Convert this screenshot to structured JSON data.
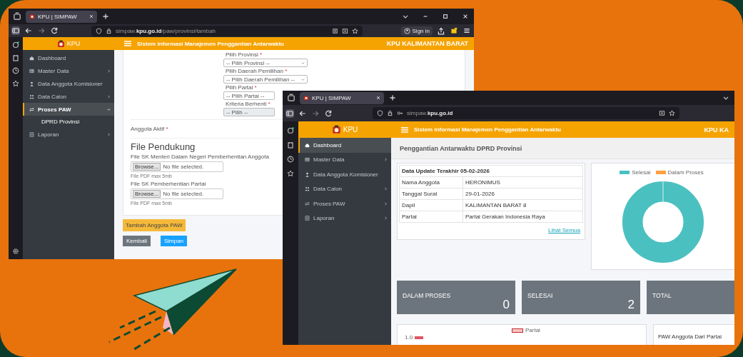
{
  "back_window": {
    "tab_title": "KPU | SIMPAW",
    "url": "simpaw.**kpu.go.id**/paw/provinsi/tambah",
    "sign_in": "Sign in",
    "app": {
      "logo": "KPU",
      "system_title": "Sistem Informasi Manajemen Penggantian Antarwaktu",
      "region": "KPU KALIMANTAN BARAT"
    },
    "sidebar": [
      {
        "label": "Dashboard",
        "selected": false,
        "expandable": false,
        "expanded": false
      },
      {
        "label": "Master Data",
        "selected": false,
        "expandable": true,
        "expanded": false
      },
      {
        "label": "Data Anggota Komisioner",
        "selected": false,
        "expandable": false,
        "expanded": false
      },
      {
        "label": "Data Calon",
        "selected": false,
        "expandable": true,
        "expanded": false
      },
      {
        "label": "Proses PAW",
        "selected": true,
        "expandable": true,
        "expanded": true,
        "children": [
          {
            "label": "DPRD Provinsi"
          }
        ]
      },
      {
        "label": "Laporan",
        "selected": false,
        "expandable": true,
        "expanded": false
      }
    ],
    "fields": [
      {
        "label": "Pilih Provinsi",
        "required_mark": "*",
        "placeholder": "-- Pilih Provinsi --",
        "disabled": false
      },
      {
        "label": "Pilih Daerah Pemilihan",
        "required_mark": "*",
        "placeholder": "-- Pilih Daerah Pemilihan --",
        "disabled": false
      },
      {
        "label": "Pilih Partai",
        "required_mark": "*",
        "placeholder": "-- Pilih Partai --",
        "disabled": false
      },
      {
        "label": "Kriteria Berhenti",
        "required_mark": "*",
        "placeholder": "-- Pilih --",
        "disabled": true
      }
    ],
    "anggota_aktif": {
      "label": "Anggota Aktif",
      "required_mark": "*"
    },
    "section_title": "File Pendukung",
    "uploads": [
      {
        "label": "File SK Menteri Dalam Negeri Pemberhentian Anggota",
        "button": "Browse...",
        "status": "No file selected.",
        "hint": "File PDF max 5mb"
      },
      {
        "label": "File SK Pemberhentian Partai",
        "button": "Browse...",
        "status": "No file selected.",
        "hint": "File PDF max 5mb"
      }
    ],
    "add_button": "Tambah Anggota PAW",
    "actions": [
      {
        "label": "Kembali",
        "kind": "secondary"
      },
      {
        "label": "Simpan",
        "kind": "primary"
      }
    ]
  },
  "front_window": {
    "tab_title": "KPU | SIMPAW",
    "url": "simpaw.**kpu.go.id**",
    "app": {
      "logo": "KPU",
      "system_title": "Sistem Informasi Manajemen Penggantian Antarwaktu",
      "region": "KPU KA"
    },
    "sidebar": [
      {
        "label": "Dashboard",
        "selected": true,
        "expandable": false
      },
      {
        "label": "Master Data",
        "selected": false,
        "expandable": true
      },
      {
        "label": "Data Anggota Komisioner",
        "selected": false,
        "expandable": false
      },
      {
        "label": "Data Calon",
        "selected": false,
        "expandable": true
      },
      {
        "label": "Proses PAW",
        "selected": false,
        "expandable": true
      },
      {
        "label": "Laporan",
        "selected": false,
        "expandable": true
      }
    ],
    "page_title": "Penggantian Antarwaktu DPRD Provinsi",
    "info_table": {
      "header": "Data Update Terakhir 05-02-2026",
      "rows": [
        {
          "label": "Nama Anggota",
          "value": "HERONIMUS"
        },
        {
          "label": "Tanggal Surat",
          "value": "29-01-2026"
        },
        {
          "label": "Dapil",
          "value": "KALIMANTAN BARAT 8"
        },
        {
          "label": "Partai",
          "value": "Partai Gerakan Indonesia Raya"
        }
      ],
      "link": "Lihat Semua"
    },
    "chart_legend": [
      {
        "label": "Selesai",
        "color": "#4bc0c0"
      },
      {
        "label": "Dalam Proses",
        "color": "#ff9f40"
      }
    ],
    "stats": [
      {
        "label": "DALAM PROSES",
        "value": "0"
      },
      {
        "label": "SELESAI",
        "value": "2"
      },
      {
        "label": "TOTAL"
      }
    ],
    "party_chart": {
      "legend": "Partai",
      "tick": "1.0"
    },
    "party_table_title": "PAW Anggota Dari Partai"
  }
}
